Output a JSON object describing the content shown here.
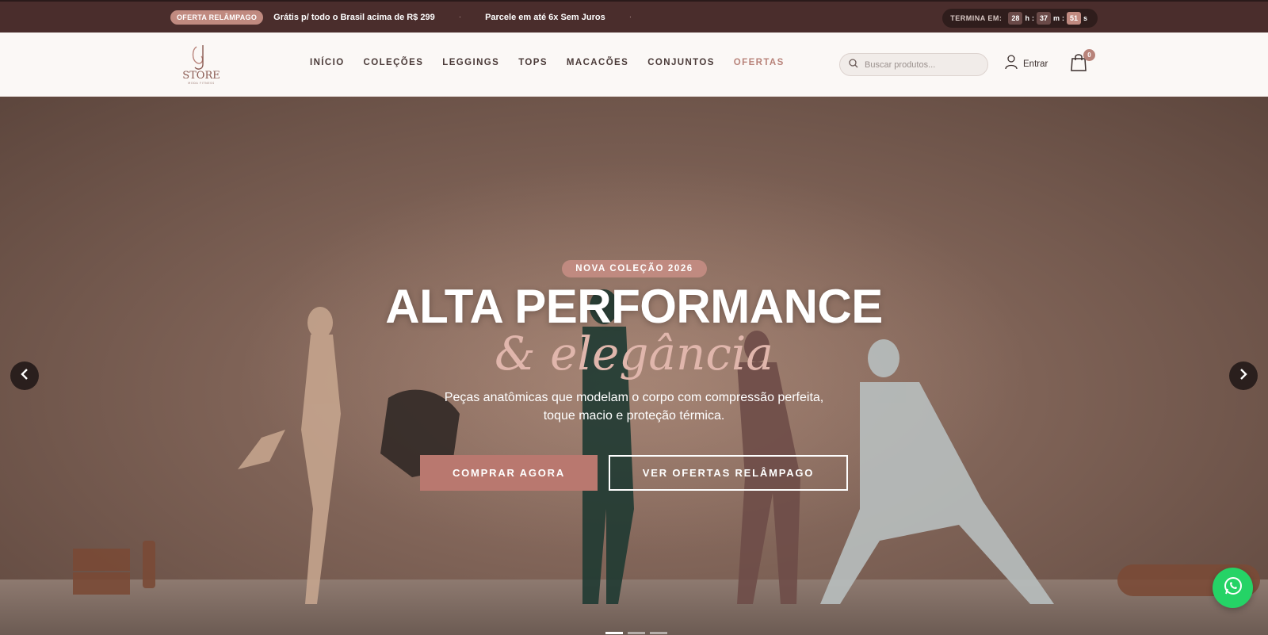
{
  "topbar": {
    "flash_badge": "OFERTA RELÂMPAGO",
    "announcements": [
      "Grátis p/ todo o Brasil acima de R$ 299",
      "Parcele em até 6x Sem Juros"
    ],
    "separator": "·",
    "timer": {
      "label": "TERMINA EM:",
      "hours": "28",
      "hours_unit": "h",
      "minutes": "37",
      "minutes_unit": "m",
      "seconds": "51",
      "seconds_unit": "s",
      "colon": ":"
    }
  },
  "header": {
    "logo_text": "STORE",
    "logo_sub": "MODA FITNESS",
    "nav": [
      "INÍCIO",
      "COLEÇÕES",
      "LEGGINGS",
      "TOPS",
      "MACACÕES",
      "CONJUNTOS",
      "OFERTAS"
    ],
    "active_nav": "OFERTAS",
    "search_placeholder": "Buscar produtos...",
    "login_label": "Entrar",
    "cart_count": "0"
  },
  "hero": {
    "badge": "NOVA COLEÇÃO 2026",
    "title": "ALTA PERFORMANCE",
    "script": "& elegância",
    "subtitle": "Peças anatômicas que modelam o corpo com compressão perfeita, toque macio e proteção térmica.",
    "primary_button": "COMPRAR AGORA",
    "secondary_button": "VER OFERTAS RELÂMPAGO"
  },
  "colors": {
    "topbar_bg": "#4a2d2c",
    "accent": "#b8837a",
    "button_primary": "#b9786f",
    "whatsapp": "#25d366"
  },
  "icons": [
    "search-icon",
    "user-icon",
    "shopping-bag-icon",
    "chevron-left-icon",
    "chevron-right-icon",
    "whatsapp-icon"
  ]
}
